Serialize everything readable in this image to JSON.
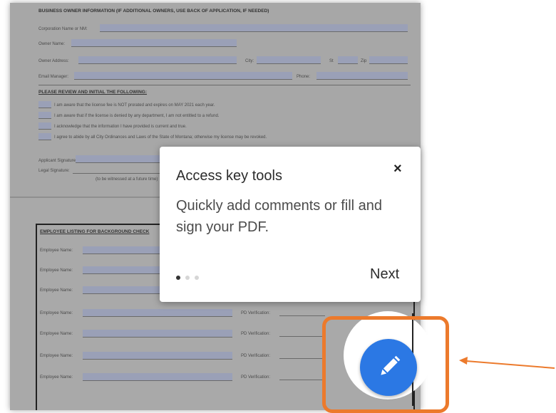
{
  "document": {
    "section_heading": "BUSINESS OWNER INFORMATION (IF ADDITIONAL OWNERS, USE BACK OF APPLICATION, IF NEEDED)",
    "fields": [
      {
        "label": "Corporation Name or NM:"
      },
      {
        "label": "Owner Name:"
      },
      {
        "label": "Owner Address:"
      },
      {
        "label": "Email Manager:"
      }
    ],
    "city_label": "City:",
    "st_label": "St",
    "zip_label": "Zip",
    "phone_label": "Phone:",
    "review_heading": "PLEASE REVIEW AND INITIAL THE FOLLOWING:",
    "review_items": [
      "I am aware that the license fee is NOT prorated and expires on MAY 2021 each year.",
      "I am aware that if the license is denied by any department, I am not entitled to a refund.",
      "I acknowledge that the information I have provided is current and true.",
      "I agree to abide by all City Ordinances and Laws of the State of Montana; otherwise my license may be revoked."
    ],
    "applicant_signature": "Applicant Signature:",
    "legal_signature": "Legal Signature:",
    "notary_note": "(to be witnessed at a future time)",
    "employee_heading": "EMPLOYEE LISTING FOR BACKGROUND CHECK",
    "employee_label": "Employee Name:",
    "verification_label": "PD Verification:"
  },
  "popup": {
    "title": "Access key tools",
    "body": "Quickly add comments or fill and sign your PDF.",
    "next_label": "Next",
    "close_icon": "×",
    "page_dots": 3,
    "active_dot": 0
  },
  "fab": {
    "icon": "pencil-icon"
  },
  "annotation": {
    "highlight_color": "#ec7a2c",
    "arrow_color": "#ec7a2c"
  }
}
